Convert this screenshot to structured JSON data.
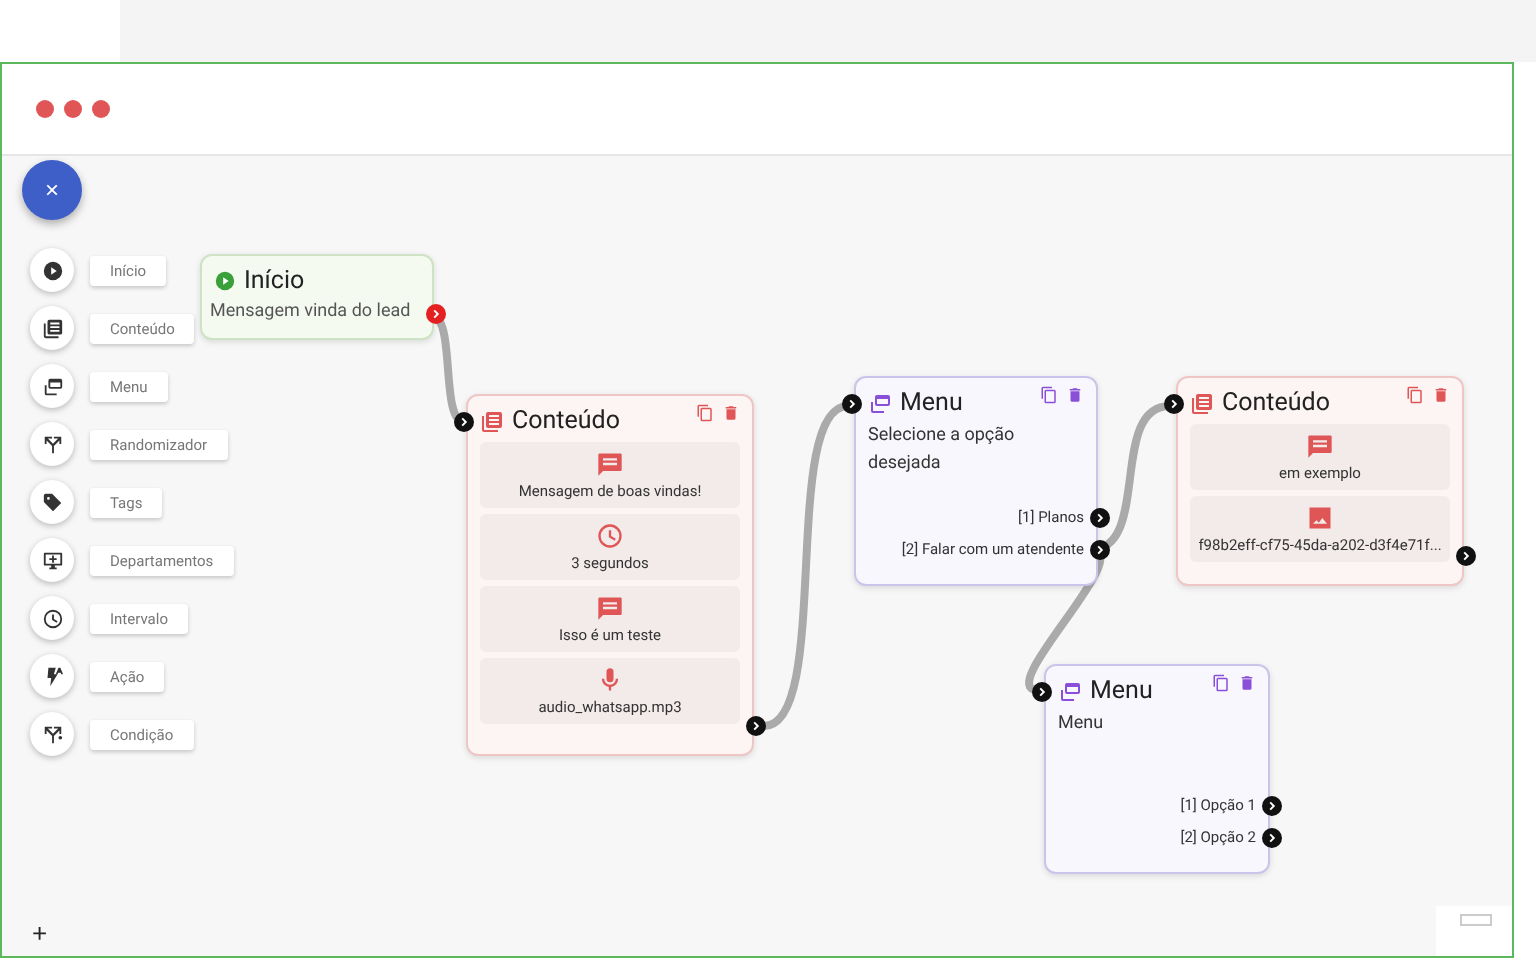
{
  "fab": {
    "label": "×"
  },
  "palette": [
    {
      "label": "Início"
    },
    {
      "label": "Conteúdo"
    },
    {
      "label": "Menu"
    },
    {
      "label": "Randomizador"
    },
    {
      "label": "Tags"
    },
    {
      "label": "Departamentos"
    },
    {
      "label": "Intervalo"
    },
    {
      "label": "Ação"
    },
    {
      "label": "Condição"
    }
  ],
  "nodes": [
    {
      "kind": "start",
      "title": "Início",
      "text": "Mensagem vinda do lead"
    },
    {
      "kind": "content",
      "title": "Conteúdo",
      "items": [
        {
          "kind": "message",
          "text": "Mensagem de boas vindas!"
        },
        {
          "kind": "interval",
          "text": "3 segundos"
        },
        {
          "kind": "message",
          "text": "Isso é um teste"
        },
        {
          "kind": "audio",
          "text": "audio_whatsapp.mp3"
        }
      ]
    },
    {
      "kind": "menu",
      "title": "Menu",
      "text": "Selecione a opção desejada",
      "options": [
        "[1] Planos",
        "[2] Falar com um atendente"
      ]
    },
    {
      "kind": "content",
      "title": "Conteúdo",
      "items": [
        {
          "kind": "message",
          "text": "em exemplo"
        },
        {
          "kind": "image",
          "text": "f98b2eff-cf75-45da-a202-d3f4e71f..."
        }
      ]
    },
    {
      "kind": "menu",
      "title": "Menu",
      "text": "Menu",
      "options": [
        "[1] Opção 1",
        "[2] Opção 2"
      ]
    }
  ],
  "add_button": {
    "label": "+"
  }
}
